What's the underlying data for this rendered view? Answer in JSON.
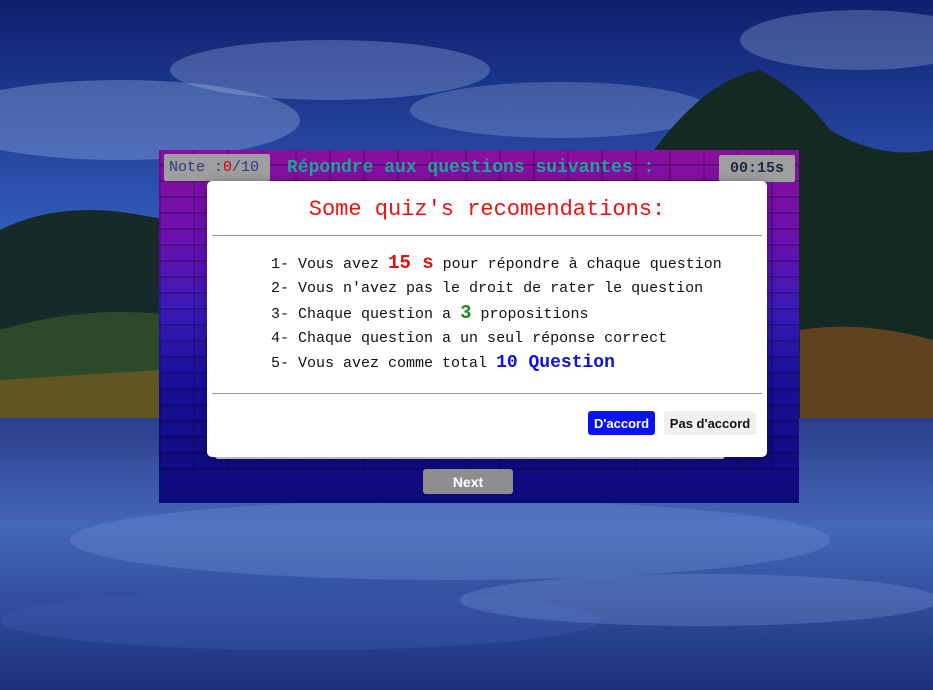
{
  "colors": {
    "accent_red": "#ee1111",
    "accent_green": "#1e8a1e",
    "accent_blue": "#1010d8",
    "ok_button": "#0a12f0",
    "title_teal": "#1fa39a"
  },
  "header": {
    "note_label": "Note :",
    "score": "0",
    "total": "/10",
    "title": "Répondre aux questions suivantes :",
    "timer": "00:15s"
  },
  "modal": {
    "title": "Some quiz's recomendations:",
    "rules": [
      {
        "num": "1-",
        "pre": "Vous avez ",
        "highlight": "15 s",
        "post": " pour répondre à chaque question"
      },
      {
        "num": "2-",
        "pre": "Vous n'avez pas le droit de rater le question",
        "highlight": "",
        "post": ""
      },
      {
        "num": "3-",
        "pre": "Chaque question a ",
        "highlight": "3",
        "post": " propositions"
      },
      {
        "num": "4-",
        "pre": "Chaque question a un seul réponse correct",
        "highlight": "",
        "post": ""
      },
      {
        "num": "5-",
        "pre": "Vous avez comme total ",
        "highlight": "10 Question",
        "post": ""
      }
    ],
    "ok_label": "D'accord",
    "cancel_label": "Pas d'accord"
  },
  "footer": {
    "next_label": "Next"
  }
}
